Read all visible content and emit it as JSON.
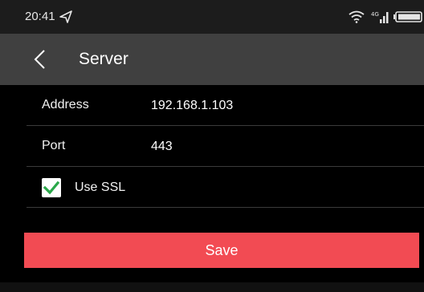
{
  "status_bar": {
    "time": "20:41",
    "icons": [
      "location-arrow-icon",
      "wifi-icon",
      "signal-icon",
      "battery-icon"
    ]
  },
  "header": {
    "back_icon": "chevron-left-icon",
    "title": "Server"
  },
  "form": {
    "address": {
      "label": "Address",
      "value": "192.168.1.103"
    },
    "port": {
      "label": "Port",
      "value": "443"
    },
    "ssl": {
      "label": "Use SSL",
      "checked": true
    }
  },
  "actions": {
    "save_label": "Save"
  },
  "colors": {
    "status_bar_bg": "#1c1c1c",
    "app_bar_bg": "#404040",
    "background": "#000000",
    "divider": "#3b3b3b",
    "save_button": "#f24b53",
    "checkbox_check": "#2aa84a"
  }
}
